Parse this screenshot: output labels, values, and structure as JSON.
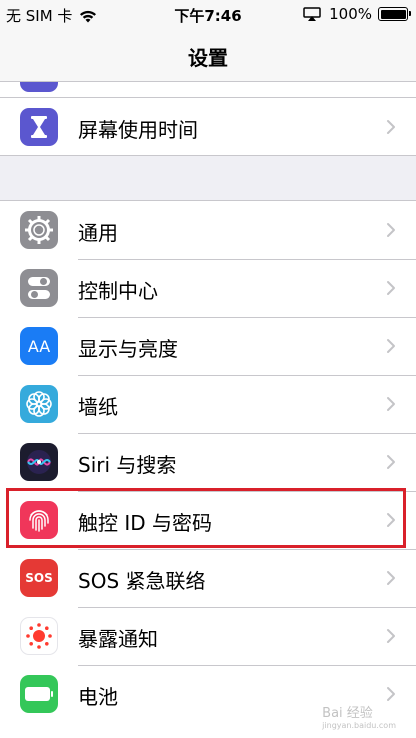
{
  "status_bar": {
    "carrier": "无 SIM 卡",
    "time": "下午7:46",
    "battery": "100%",
    "battery_level": 1.0
  },
  "nav": {
    "title": "设置"
  },
  "groups": [
    {
      "items": [
        {
          "label": "屏幕使用时间",
          "icon": "hourglass-icon",
          "color": "#5b57cf"
        }
      ]
    },
    {
      "items": [
        {
          "label": "通用",
          "icon": "gear-icon",
          "color": "#8e8e93"
        },
        {
          "label": "控制中心",
          "icon": "toggles-icon",
          "color": "#8e8e93"
        },
        {
          "label": "显示与亮度",
          "icon": "text-size-icon",
          "color": "#1a7cf5",
          "icon_text": "AA"
        },
        {
          "label": "墙纸",
          "icon": "flower-icon",
          "color": "#35aadc"
        },
        {
          "label": "Siri 与搜索",
          "icon": "siri-icon",
          "color": "#1c1c2e"
        },
        {
          "label": "触控 ID 与密码",
          "icon": "fingerprint-icon",
          "color": "#f0365a"
        },
        {
          "label": "SOS 紧急联络",
          "icon": "sos-icon",
          "color": "#e53935",
          "icon_text": "SOS"
        },
        {
          "label": "暴露通知",
          "icon": "exposure-icon",
          "color": "#ffffff"
        },
        {
          "label": "电池",
          "icon": "battery-icon",
          "color": "#34c759"
        }
      ]
    }
  ],
  "highlight_color": "#d9202a",
  "watermark": {
    "text": "Bai 经验",
    "sub": "jingyan.baidu.com"
  }
}
